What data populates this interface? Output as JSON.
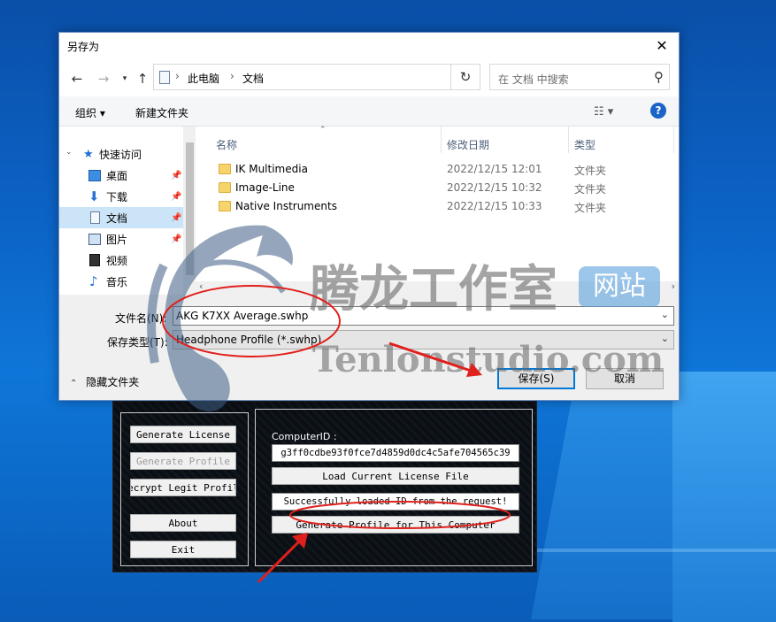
{
  "dialog": {
    "title": "另存为",
    "breadcrumb": [
      "此电脑",
      "文档"
    ],
    "search_placeholder": "在 文档 中搜索",
    "toolbar": {
      "organize": "组织 ▾",
      "new_folder": "新建文件夹"
    },
    "nav_items": [
      {
        "label": "快速访问",
        "icon": "star-icon"
      },
      {
        "label": "桌面",
        "icon": "desktop-icon"
      },
      {
        "label": "下载",
        "icon": "download-icon"
      },
      {
        "label": "文档",
        "icon": "document-icon",
        "selected": true
      },
      {
        "label": "图片",
        "icon": "picture-icon"
      },
      {
        "label": "视频",
        "icon": "video-icon"
      },
      {
        "label": "音乐",
        "icon": "music-icon"
      }
    ],
    "columns": {
      "name": "名称",
      "modified": "修改日期",
      "type": "类型"
    },
    "files": [
      {
        "name": "IK Multimedia",
        "modified": "2022/12/15 12:01",
        "type": "文件夹"
      },
      {
        "name": "Image-Line",
        "modified": "2022/12/15 10:32",
        "type": "文件夹"
      },
      {
        "name": "Native Instruments",
        "modified": "2022/12/15 10:33",
        "type": "文件夹"
      }
    ],
    "filename_label": "文件名(N):",
    "filename_value": "AKG K7XX Average.swhp",
    "filetype_label": "保存类型(T):",
    "filetype_value": "Headphone Profile (*.swhp)",
    "hide_folders": "隐藏文件夹",
    "save_button": "保存(S)",
    "cancel_button": "取消"
  },
  "generator": {
    "buttons_left": {
      "generate_license": "Generate License",
      "generate_profile": "Generate Profile",
      "decrypt_legit": "ecrypt Legit Profil",
      "about": "About",
      "exit": "Exit"
    },
    "computer_id_label": "ComputerID :",
    "computer_id_value": "g3ff0cdbe93f0fce7d4859d0dc4c5afe704565c39",
    "load_license": "Load Current License File",
    "status": "Successfully loaded ID from the request!",
    "generate_for_computer": "Generate Profile for This Computer"
  },
  "watermark": {
    "cn_text": "腾龙工作室",
    "badge": "网站",
    "en_text": "Tenlonstudio.com"
  },
  "colors": {
    "annotation_red": "#e0201c",
    "accent_blue": "#0078d7",
    "selection": "#cce4f7"
  }
}
